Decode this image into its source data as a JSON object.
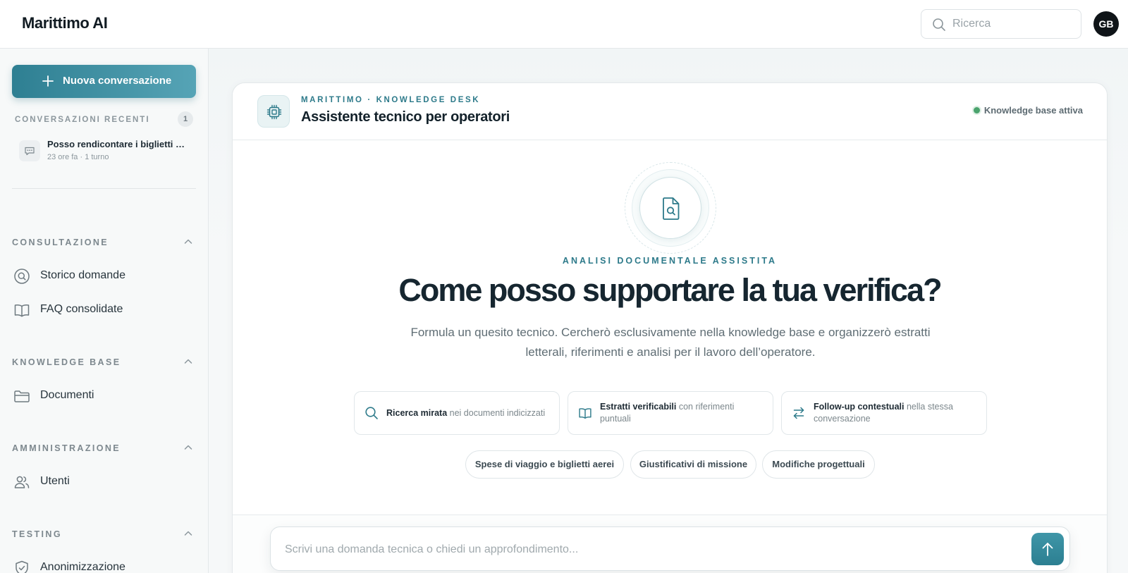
{
  "app": {
    "brand": "Marittimo AI",
    "avatar_initials": "GB"
  },
  "search": {
    "placeholder": "Ricerca"
  },
  "sidebar": {
    "new_conversation_label": "Nuova conversazione",
    "recent_title": "CONVERSAZIONI RECENTI",
    "recent_count": "1",
    "recent_items": [
      {
        "title": "Posso rendicontare i biglietti aerei?",
        "meta": "23 ore fa · 1 turno"
      }
    ],
    "sections": [
      {
        "title": "CONSULTAZIONE",
        "items": [
          {
            "label": "Storico domande",
            "icon": "history-search-icon"
          },
          {
            "label": "FAQ consolidate",
            "icon": "book-icon"
          }
        ]
      },
      {
        "title": "KNOWLEDGE BASE",
        "items": [
          {
            "label": "Documenti",
            "icon": "folder-icon"
          }
        ]
      },
      {
        "title": "AMMINISTRAZIONE",
        "items": [
          {
            "label": "Utenti",
            "icon": "users-icon"
          }
        ]
      },
      {
        "title": "TESTING",
        "items": [
          {
            "label": "Anonimizzazione",
            "icon": "shield-icon"
          }
        ]
      }
    ]
  },
  "card": {
    "eyebrow": "MARITTIMO · KNOWLEDGE DESK",
    "title": "Assistente tecnico per operatori",
    "kb_status": "Knowledge base attiva",
    "hero_eyebrow": "ANALISI DOCUMENTALE ASSISTITA",
    "hero_title": "Come posso supportare la tua verifica?",
    "hero_subtitle": "Formula un quesito tecnico. Cercherò esclusivamente nella knowledge base e organizzerò estratti letterali, riferimenti e analisi per il lavoro dell’operatore.",
    "features": [
      {
        "bold": "Ricerca mirata",
        "rest": " nei documenti indicizzati"
      },
      {
        "bold": "Estratti verificabili",
        "rest": " con riferimenti puntuali"
      },
      {
        "bold": "Follow-up contestuali",
        "rest": " nella stessa conversazione"
      }
    ],
    "suggestions": [
      "Spese di viaggio e biglietti aerei",
      "Giustificativi di missione",
      "Modifiche progettuali"
    ]
  },
  "composer": {
    "placeholder": "Scrivi una domanda tecnica o chiedi un approfondimento..."
  },
  "colors": {
    "accent": "#2d7a8a",
    "status_green": "#4aa36d"
  }
}
